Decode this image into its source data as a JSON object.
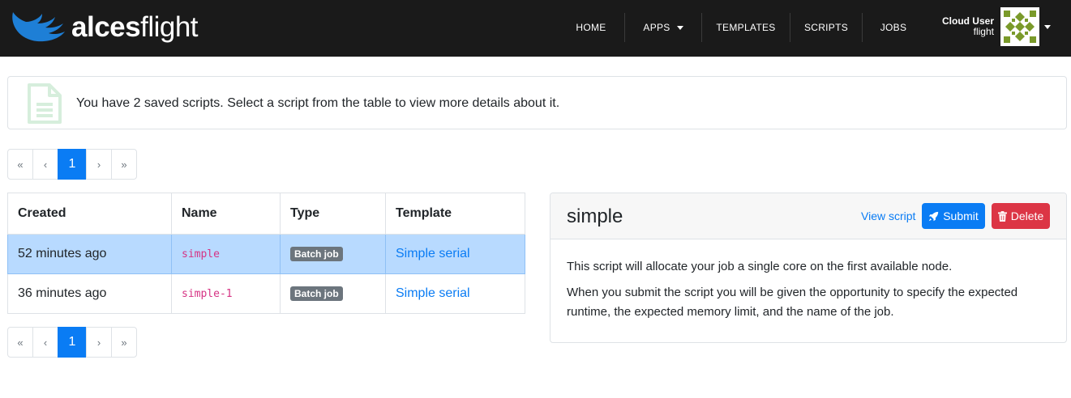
{
  "brand": {
    "logo_bold": "alces",
    "logo_light": "flight"
  },
  "nav": {
    "items": [
      {
        "label": "HOME"
      },
      {
        "label": "APPS"
      },
      {
        "label": "TEMPLATES"
      },
      {
        "label": "SCRIPTS"
      },
      {
        "label": "JOBS"
      }
    ],
    "user": {
      "name": "Cloud User",
      "login": "flight"
    }
  },
  "alert": {
    "text": "You have 2 saved scripts. Select a script from the table to view more details about it."
  },
  "pagination": {
    "first": "«",
    "prev": "‹",
    "current": "1",
    "next": "›",
    "last": "»"
  },
  "table": {
    "headers": [
      "Created",
      "Name",
      "Type",
      "Template"
    ],
    "rows": [
      {
        "created": "52 minutes ago",
        "name": "simple",
        "type": "Batch job",
        "template": "Simple serial",
        "selected": true
      },
      {
        "created": "36 minutes ago",
        "name": "simple-1",
        "type": "Batch job",
        "template": "Simple serial",
        "selected": false
      }
    ]
  },
  "detail": {
    "title": "simple",
    "view_label": "View script",
    "submit_label": "Submit",
    "delete_label": "Delete",
    "paragraphs": [
      "This script will allocate your job a single core on the first available node.",
      "When you submit the script you will be given the opportunity to specify the expected runtime, the expected memory limit, and the name of the job."
    ]
  },
  "colors": {
    "primary": "#0a7cf4",
    "danger": "#dc3545",
    "navbar": "#1a1a1a",
    "selected_row": "#b8daff"
  }
}
